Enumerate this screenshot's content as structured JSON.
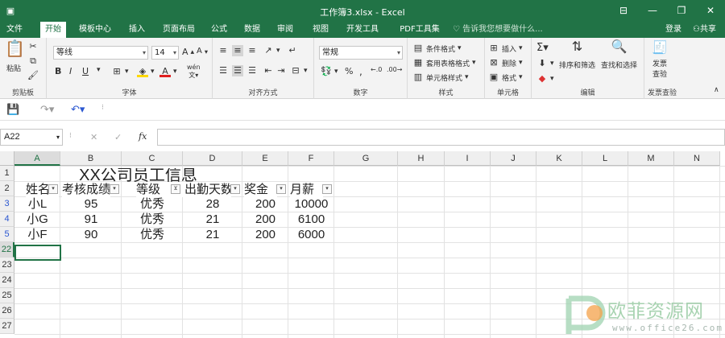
{
  "window": {
    "title": "工作簿3.xlsx - Excel",
    "minimize": "—",
    "restore": "❐",
    "close": "✕"
  },
  "tabs": [
    "文件",
    "开始",
    "模板中心",
    "插入",
    "页面布局",
    "公式",
    "数据",
    "审阅",
    "视图",
    "开发工具",
    "PDF工具集"
  ],
  "tellme": "告诉我您想要做什么...",
  "login": "登录",
  "share": "共享",
  "ribbon": {
    "clipboard": {
      "label": "剪贴板",
      "paste": "粘贴"
    },
    "font": {
      "label": "字体",
      "name": "等线",
      "size": "14",
      "bold": "B",
      "italic": "I",
      "underline": "U",
      "phonetic": "wén"
    },
    "align": {
      "label": "对齐方式"
    },
    "number": {
      "label": "数字",
      "format": "常规",
      "percent": "%",
      "comma": ","
    },
    "styles": {
      "label": "样式",
      "cond": "条件格式",
      "table": "套用表格格式",
      "cell": "单元格样式"
    },
    "cells": {
      "label": "单元格",
      "insert": "插入",
      "delete": "删除",
      "format": "格式"
    },
    "edit": {
      "label": "编辑",
      "sort": "排序和筛选",
      "find": "查找和选择"
    },
    "invoice": {
      "label": "发票查验",
      "btn1": "发票",
      "btn2": "查验"
    }
  },
  "namebox": "A22",
  "fx": "fx",
  "columns": [
    "A",
    "B",
    "C",
    "D",
    "E",
    "F",
    "G",
    "H",
    "I",
    "J",
    "K",
    "L",
    "M",
    "N"
  ],
  "rows": [
    "1",
    "2",
    "3",
    "4",
    "5",
    "22",
    "23",
    "24",
    "25",
    "26",
    "27"
  ],
  "sheet": {
    "title": "XX公司员工信息",
    "headers": [
      "姓名",
      "考核成绩",
      "等级",
      "出勤天数",
      "奖金",
      "月薪"
    ],
    "data": [
      [
        "小L",
        "95",
        "优秀",
        "28",
        "200",
        "10000"
      ],
      [
        "小G",
        "91",
        "优秀",
        "21",
        "200",
        "6100"
      ],
      [
        "小F",
        "90",
        "优秀",
        "21",
        "200",
        "6000"
      ]
    ]
  },
  "watermark": {
    "name": "欧菲资源网",
    "url": "www.office26.com"
  },
  "colors": {
    "brand": "#217346",
    "rowFiltered": "#2b57d1"
  }
}
